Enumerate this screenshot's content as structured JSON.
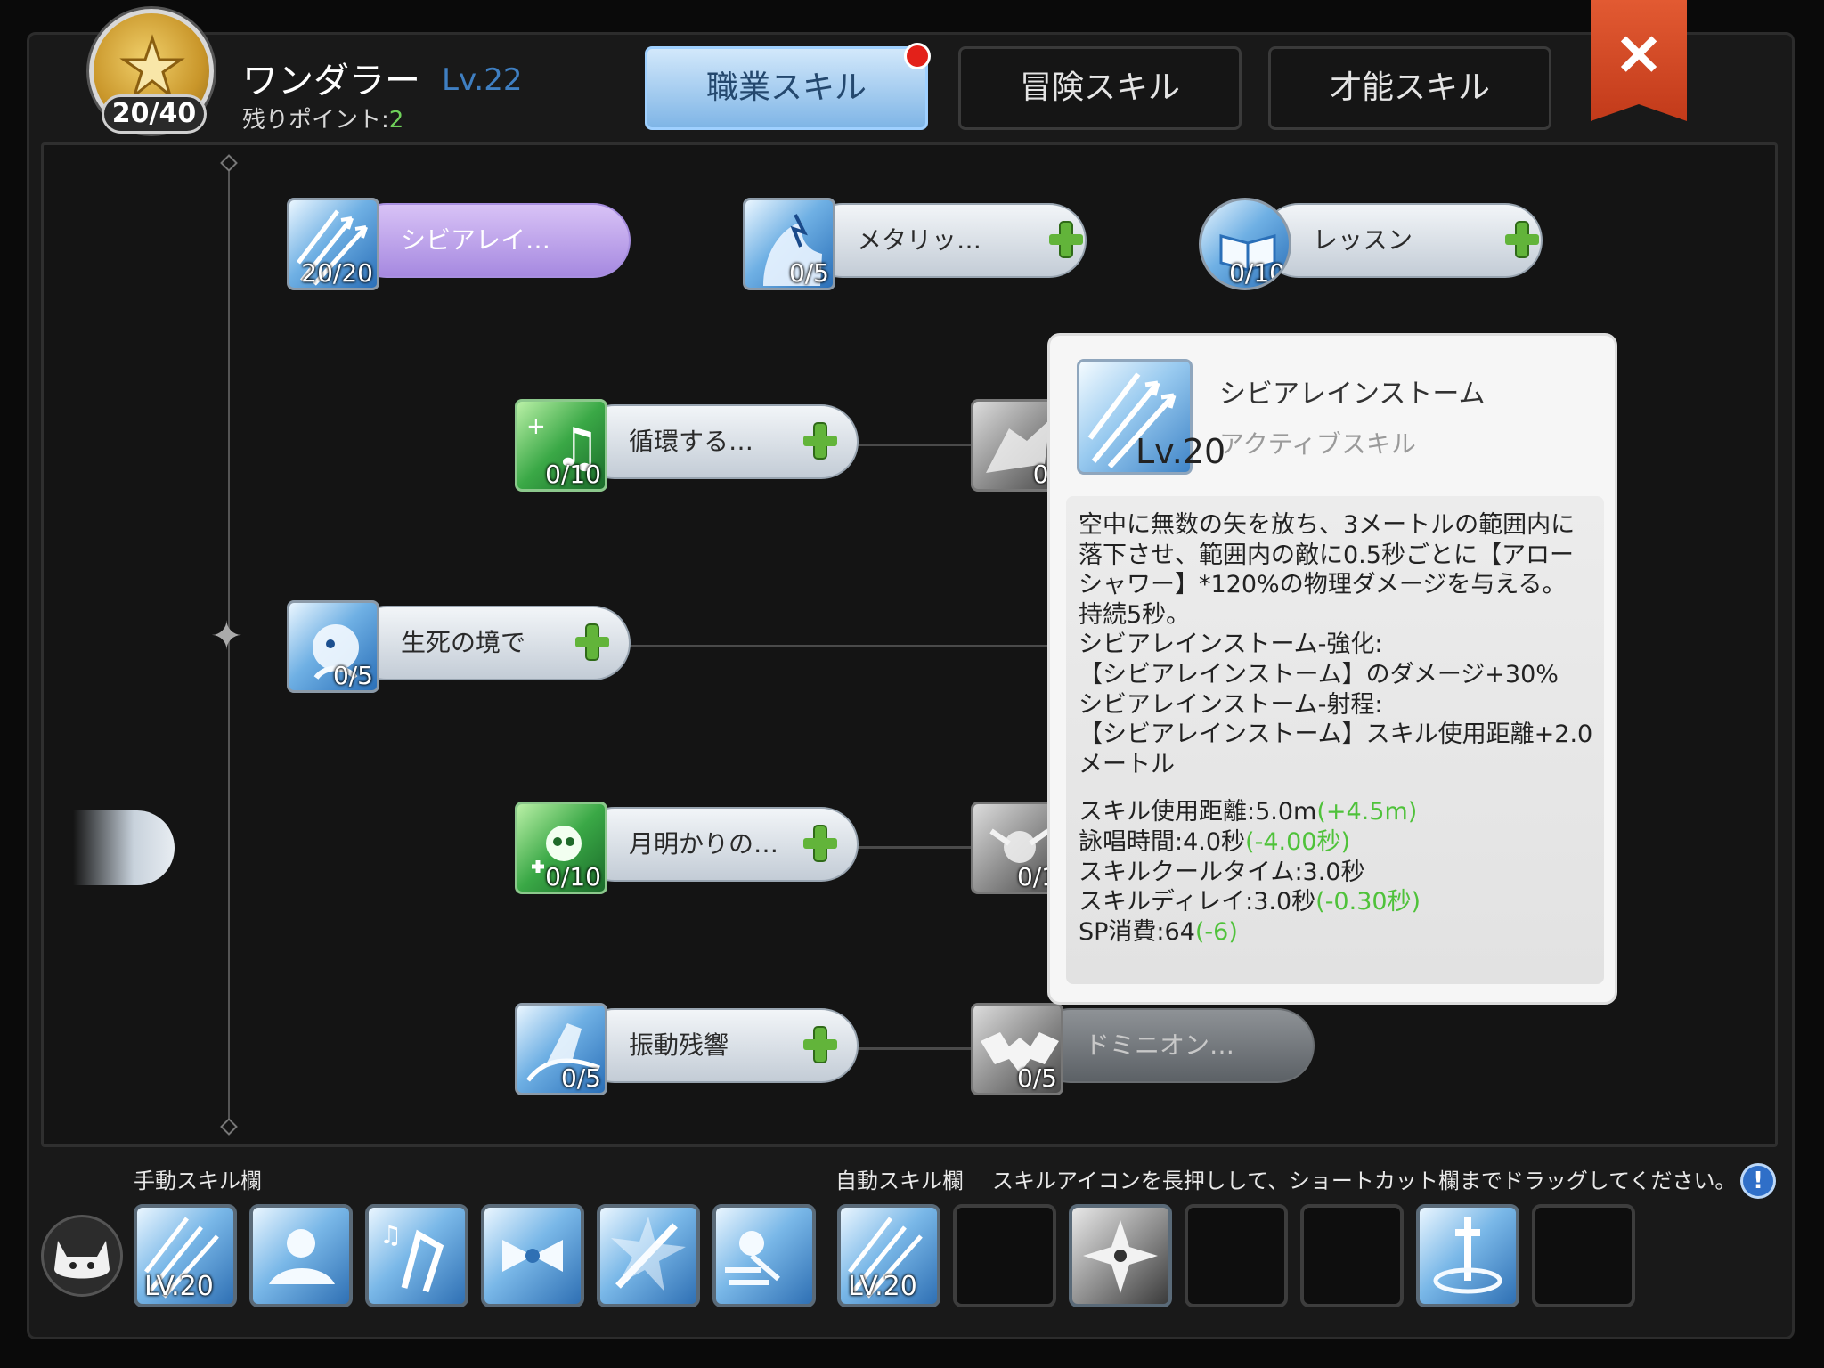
{
  "header": {
    "job_count": "20/40",
    "job_name": "ワンダラー",
    "job_level": "Lv.22",
    "points_label": "残りポイント:",
    "points_value": "2",
    "close_label": "✕"
  },
  "tabs": [
    {
      "label": "職業スキル",
      "active": true,
      "has_notification": true
    },
    {
      "label": "冒険スキル",
      "active": false
    },
    {
      "label": "才能スキル",
      "active": false
    }
  ],
  "skills": [
    {
      "label": "シビアレイ…",
      "count": "20/20",
      "icon": "arrow-storm-icon"
    },
    {
      "label": "メタリッ…",
      "count": "0/5",
      "icon": "metallic-voice-icon"
    },
    {
      "label": "レッスン",
      "count": "0/10",
      "icon": "lesson-book-icon"
    },
    {
      "label": "循環する…",
      "count": "0/10",
      "icon": "music-note-icon"
    },
    {
      "label": "",
      "count": "0/",
      "icon": "wolf-icon"
    },
    {
      "label": "生死の境で",
      "count": "0/5",
      "icon": "spirit-icon"
    },
    {
      "label": "月明かりの…",
      "count": "0/10",
      "icon": "skull-music-icon"
    },
    {
      "label": "",
      "count": "0/1",
      "icon": "dancer-icon"
    },
    {
      "label": "振動残響",
      "count": "0/5",
      "icon": "vibration-icon"
    },
    {
      "label": "ドミニオン…",
      "count": "0/5",
      "icon": "bat-icon"
    }
  ],
  "tooltip": {
    "name": "シビアレインストーム",
    "type": "アクティブスキル",
    "level": "Lv.20",
    "description": [
      "空中に無数の矢を放ち、3メートルの範囲内に",
      "落下させ、範囲内の敵に0.5秒ごとに【アロー",
      "シャワー】*120%の物理ダメージを与える。",
      "持続5秒。",
      "シビアレインストーム-強化:",
      "【シビアレインストーム】のダメージ+30%",
      "シビアレインストーム-射程:",
      "【シビアレインストーム】スキル使用距離+2.0",
      "メートル"
    ],
    "stats": [
      {
        "label": "スキル使用距離:5.0m",
        "bonus": "(+4.5m)"
      },
      {
        "label": "詠唱時間:4.0秒",
        "bonus": "(-4.00秒)"
      },
      {
        "label": "スキルクールタイム:3.0秒",
        "bonus": ""
      },
      {
        "label": "スキルディレイ:3.0秒",
        "bonus": "(-0.30秒)"
      },
      {
        "label": "SP消費:64",
        "bonus": "(-6)"
      }
    ]
  },
  "bottom": {
    "manual_label": "手動スキル欄",
    "auto_label": "自動スキル欄",
    "hint": "スキルアイコンを長押しして、ショートカット欄までドラッグしてください。",
    "info_icon": "!",
    "manual_slots": [
      {
        "icon": "arrow-storm-icon",
        "level": "LV.20"
      },
      {
        "icon": "rest-icon",
        "level": ""
      },
      {
        "icon": "dance-icon",
        "level": ""
      },
      {
        "icon": "bow-ribbon-icon",
        "level": ""
      },
      {
        "icon": "sword-burst-icon",
        "level": ""
      },
      {
        "icon": "dash-icon",
        "level": ""
      }
    ],
    "auto_slots": [
      {
        "icon": "arrow-storm-icon",
        "level": "LV.20"
      },
      {
        "icon": "",
        "level": ""
      },
      {
        "icon": "shuriken-icon",
        "level": ""
      },
      {
        "icon": "",
        "level": ""
      },
      {
        "icon": "",
        "level": ""
      },
      {
        "icon": "sword-aura-icon",
        "level": ""
      },
      {
        "icon": "",
        "level": ""
      }
    ]
  },
  "colors": {
    "accent": "#7fb5e6",
    "bonus_green": "#4fc23a",
    "level_blue": "#3f7fc2",
    "close_red": "#c23a1a"
  }
}
